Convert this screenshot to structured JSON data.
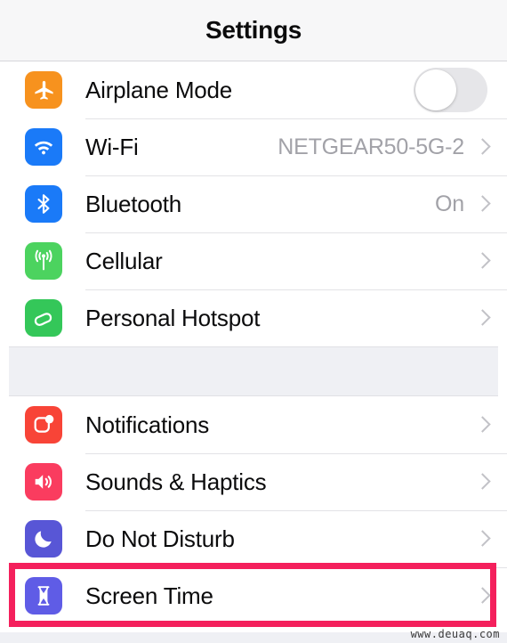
{
  "navbar": {
    "title": "Settings"
  },
  "sections": [
    {
      "id": "connectivity",
      "rows": [
        {
          "label": "Airplane Mode",
          "icon": "airplane-icon",
          "icon_color": "#f7921e",
          "accessory": "toggle",
          "toggle_on": false,
          "value": ""
        },
        {
          "label": "Wi-Fi",
          "icon": "wifi-icon",
          "icon_color": "#1a7af8",
          "accessory": "chevron",
          "value": "NETGEAR50-5G-2"
        },
        {
          "label": "Bluetooth",
          "icon": "bluetooth-icon",
          "icon_color": "#1a7af8",
          "accessory": "chevron",
          "value": "On"
        },
        {
          "label": "Cellular",
          "icon": "cellular-icon",
          "icon_color": "#4cd35f",
          "accessory": "chevron",
          "value": ""
        },
        {
          "label": "Personal Hotspot",
          "icon": "hotspot-icon",
          "icon_color": "#34c759",
          "accessory": "chevron",
          "value": ""
        }
      ]
    },
    {
      "id": "alerts",
      "rows": [
        {
          "label": "Notifications",
          "icon": "notifications-icon",
          "icon_color": "#f84437",
          "accessory": "chevron",
          "value": ""
        },
        {
          "label": "Sounds & Haptics",
          "icon": "sounds-icon",
          "icon_color": "#fa3c5f",
          "accessory": "chevron",
          "value": ""
        },
        {
          "label": "Do Not Disturb",
          "icon": "moon-icon",
          "icon_color": "#5856d6",
          "accessory": "chevron",
          "value": ""
        },
        {
          "label": "Screen Time",
          "icon": "hourglass-icon",
          "icon_color": "#5f5ce6",
          "accessory": "chevron",
          "value": "",
          "highlighted": true
        }
      ]
    }
  ],
  "highlight": {
    "color": "#f4205c",
    "target": "Screen Time"
  },
  "watermark": {
    "text": "www.deuaq.com"
  }
}
